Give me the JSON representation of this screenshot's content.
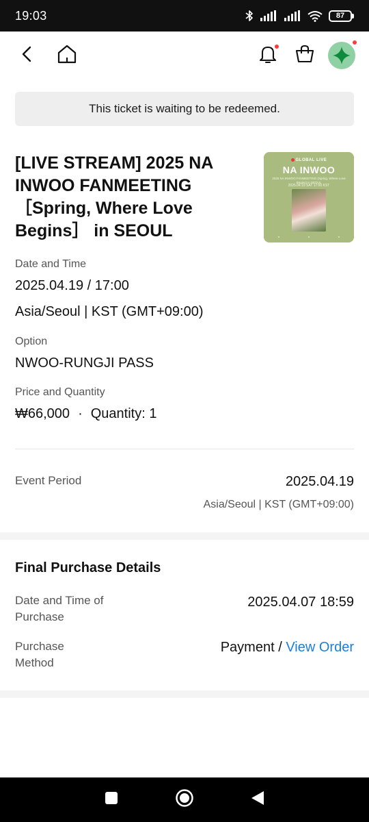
{
  "status_bar": {
    "time": "19:03",
    "battery": "87",
    "icons": [
      "bluetooth-icon",
      "signal-icon",
      "signal-icon",
      "wifi-icon",
      "battery-icon"
    ]
  },
  "app_bar": {
    "left_icons": [
      "back-arrow-icon",
      "home-icon"
    ],
    "right_icons": [
      "bell-icon",
      "shopping-bag-icon",
      "profile-avatar-icon"
    ],
    "badge_color": "#ff3b3b",
    "avatar_color": "#8fd1a4"
  },
  "notice": "This ticket is waiting to be redeemed.",
  "event": {
    "title": "[LIVE STREAM] 2025 NA INWOO FANMEETING ［Spring, Where Love Begins］ in SEOUL",
    "poster": {
      "badge": "GLOBAL LIVE",
      "name": "NA INWOO",
      "subtitle": "2025 NA INWOO FANMEETING (Spring, Where Love Begins) in SEOUL",
      "date": "2025.04.19 SAT 17:00 KST",
      "background_color": "#a9bb7f"
    }
  },
  "details": {
    "date_label": "Date and Time",
    "date_value": "2025.04.19 / 17:00",
    "timezone_value": "Asia/Seoul | KST (GMT+09:00)",
    "option_label": "Option",
    "option_value": "NWOO-RUNGJI PASS",
    "price_label": "Price and Quantity",
    "price_value": "₩66,000",
    "separator": "·",
    "quantity_value": "Quantity: 1"
  },
  "event_period": {
    "label": "Event Period",
    "date": "2025.04.19",
    "timezone": "Asia/Seoul | KST (GMT+09:00)"
  },
  "purchase": {
    "section_title": "Final Purchase Details",
    "date_label": "Date and Time of Purchase",
    "date_value": "2025.04.07 18:59",
    "method_label": "Purchase Method",
    "method_value": "Payment",
    "method_separator": " / ",
    "view_order_label": "View Order",
    "link_color": "#1a7fd9"
  },
  "nav_bar": {
    "icons": [
      "recent-apps-icon",
      "home-circle-icon",
      "back-triangle-icon"
    ]
  }
}
